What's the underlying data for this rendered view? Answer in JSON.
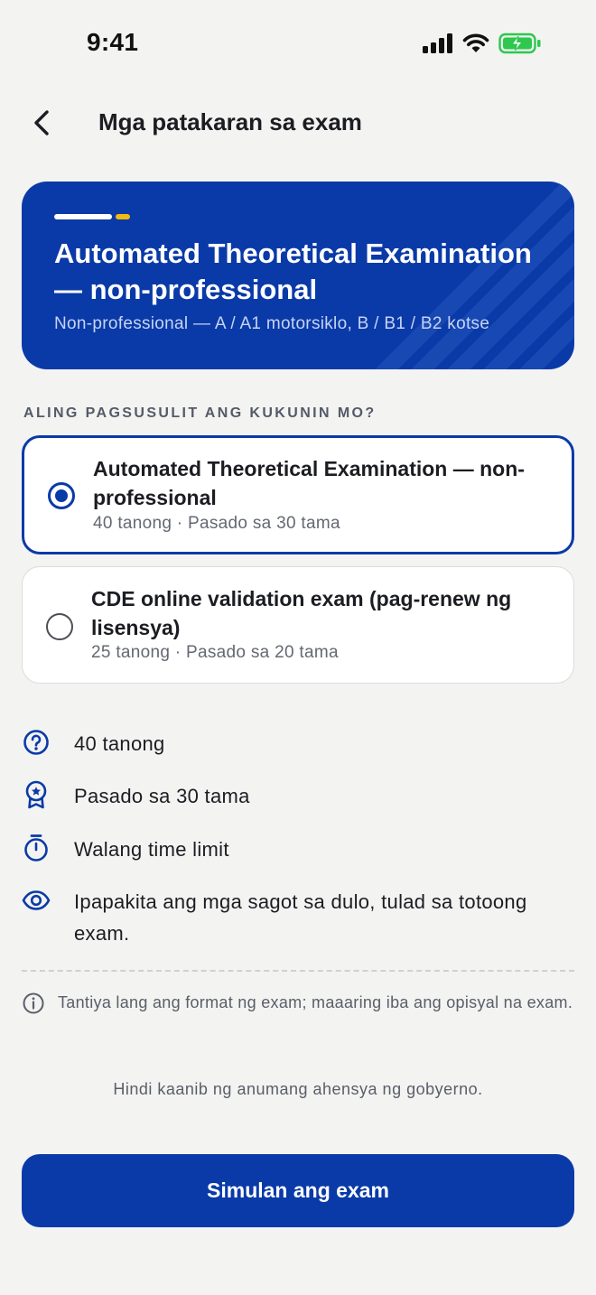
{
  "status_bar": {
    "time": "9:41"
  },
  "header": {
    "title": "Mga patakaran sa exam"
  },
  "hero": {
    "title": "Automated Theoretical Examination — non-professional",
    "subtitle": "Non-professional — A / A1 motorsiklo, B / B1 / B2 kotse"
  },
  "section_label": "ALING PAGSUSULIT ANG KUKUNIN MO?",
  "options": [
    {
      "title": "Automated Theoretical Examination — non-professional",
      "meta": "40 tanong · Pasado sa 30 tama",
      "selected": true
    },
    {
      "title": "CDE online validation exam (pag-renew ng lisensya)",
      "meta": "25 tanong · Pasado sa 20 tama",
      "selected": false
    }
  ],
  "info": [
    {
      "icon": "question-circle-icon",
      "text": "40 tanong"
    },
    {
      "icon": "award-badge-icon",
      "text": "Pasado sa 30 tama"
    },
    {
      "icon": "stopwatch-icon",
      "text": "Walang time limit"
    },
    {
      "icon": "eye-icon",
      "text": "Ipapakita ang mga sagot sa dulo, tulad sa totoong exam."
    }
  ],
  "note": "Tantiya lang ang format ng exam; maaaring iba ang opisyal na exam.",
  "disclaimer": "Hindi kaanib ng anumang ahensya ng gobyerno.",
  "cta_label": "Simulan ang exam",
  "colors": {
    "primary": "#0a3aa8",
    "accent": "#f5b812",
    "background": "#f3f3f2",
    "battery": "#2dc84d"
  }
}
